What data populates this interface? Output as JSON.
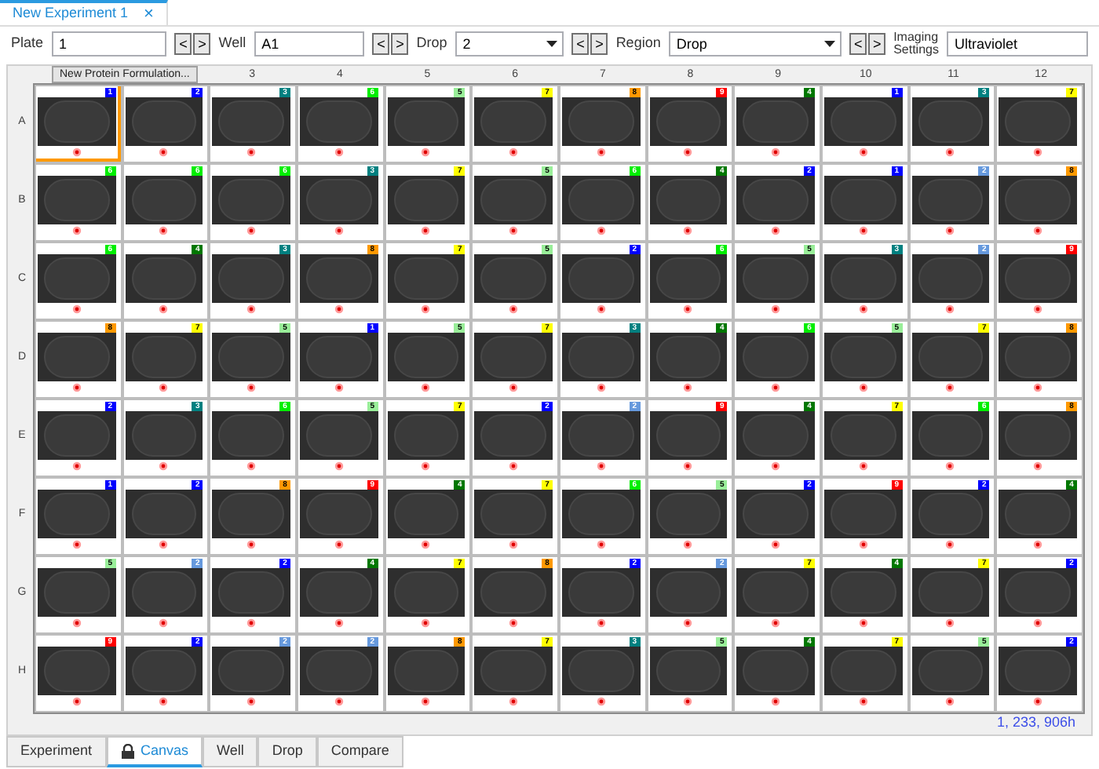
{
  "document_tab": {
    "title": "New Experiment 1",
    "close": "×"
  },
  "toolbar": {
    "plate": {
      "label": "Plate",
      "value": "1"
    },
    "well": {
      "label": "Well",
      "value": "A1"
    },
    "drop": {
      "label": "Drop",
      "value": "2"
    },
    "region": {
      "label": "Region",
      "value": "Drop"
    },
    "imaging": {
      "label": "Imaging Settings",
      "value": "Ultraviolet"
    },
    "prev": "<",
    "next": ">"
  },
  "formulation_button": "New Protein Formulation...",
  "column_headers": [
    "3",
    "4",
    "5",
    "6",
    "7",
    "8",
    "9",
    "10",
    "11",
    "12"
  ],
  "rows": [
    {
      "label": "A",
      "wells": [
        {
          "score": "1",
          "color": "#0000ff",
          "selected": true
        },
        {
          "score": "2",
          "color": "#0000ff",
          "selected": false
        },
        {
          "score": "3",
          "color": "#008080",
          "selected": false
        },
        {
          "score": "6",
          "color": "#00ee00",
          "selected": false
        },
        {
          "score": "5",
          "color": "#99ee99",
          "selected": false
        },
        {
          "score": "7",
          "color": "#ffff00",
          "selected": false
        },
        {
          "score": "8",
          "color": "#ff9900",
          "selected": false
        },
        {
          "score": "9",
          "color": "#ff0000",
          "selected": false
        },
        {
          "score": "4",
          "color": "#007700",
          "selected": false
        },
        {
          "score": "1",
          "color": "#0000ff",
          "selected": false
        },
        {
          "score": "3",
          "color": "#008080",
          "selected": false
        },
        {
          "score": "7",
          "color": "#ffff00",
          "selected": false
        }
      ]
    },
    {
      "label": "B",
      "wells": [
        {
          "score": "6",
          "color": "#00ee00",
          "selected": false
        },
        {
          "score": "6",
          "color": "#00ee00",
          "selected": false
        },
        {
          "score": "6",
          "color": "#00ee00",
          "selected": false
        },
        {
          "score": "3",
          "color": "#008080",
          "selected": false
        },
        {
          "score": "7",
          "color": "#ffff00",
          "selected": false
        },
        {
          "score": "5",
          "color": "#99ee99",
          "selected": false
        },
        {
          "score": "6",
          "color": "#00ee00",
          "selected": false
        },
        {
          "score": "4",
          "color": "#007700",
          "selected": false
        },
        {
          "score": "2",
          "color": "#0000ff",
          "selected": false
        },
        {
          "score": "1",
          "color": "#0000ff",
          "selected": false
        },
        {
          "score": "2",
          "color": "#6699dd",
          "selected": false
        },
        {
          "score": "8",
          "color": "#ff9900",
          "selected": false
        }
      ]
    },
    {
      "label": "C",
      "wells": [
        {
          "score": "6",
          "color": "#00ee00",
          "selected": false
        },
        {
          "score": "4",
          "color": "#007700",
          "selected": false
        },
        {
          "score": "3",
          "color": "#008080",
          "selected": false
        },
        {
          "score": "8",
          "color": "#ff9900",
          "selected": false
        },
        {
          "score": "7",
          "color": "#ffff00",
          "selected": false
        },
        {
          "score": "5",
          "color": "#99ee99",
          "selected": false
        },
        {
          "score": "2",
          "color": "#0000ff",
          "selected": false
        },
        {
          "score": "6",
          "color": "#00ee00",
          "selected": false
        },
        {
          "score": "5",
          "color": "#99ee99",
          "selected": false
        },
        {
          "score": "3",
          "color": "#008080",
          "selected": false
        },
        {
          "score": "2",
          "color": "#6699dd",
          "selected": false
        },
        {
          "score": "9",
          "color": "#ff0000",
          "selected": false
        }
      ]
    },
    {
      "label": "D",
      "wells": [
        {
          "score": "8",
          "color": "#ff9900",
          "selected": false
        },
        {
          "score": "7",
          "color": "#ffff00",
          "selected": false
        },
        {
          "score": "5",
          "color": "#99ee99",
          "selected": false
        },
        {
          "score": "1",
          "color": "#0000ff",
          "selected": false
        },
        {
          "score": "5",
          "color": "#99ee99",
          "selected": false
        },
        {
          "score": "7",
          "color": "#ffff00",
          "selected": false
        },
        {
          "score": "3",
          "color": "#008080",
          "selected": false
        },
        {
          "score": "4",
          "color": "#007700",
          "selected": false
        },
        {
          "score": "6",
          "color": "#00ee00",
          "selected": false
        },
        {
          "score": "5",
          "color": "#99ee99",
          "selected": false
        },
        {
          "score": "7",
          "color": "#ffff00",
          "selected": false
        },
        {
          "score": "8",
          "color": "#ff9900",
          "selected": false
        }
      ]
    },
    {
      "label": "E",
      "wells": [
        {
          "score": "2",
          "color": "#0000ff",
          "selected": false
        },
        {
          "score": "3",
          "color": "#008080",
          "selected": false
        },
        {
          "score": "6",
          "color": "#00ee00",
          "selected": false
        },
        {
          "score": "5",
          "color": "#99ee99",
          "selected": false
        },
        {
          "score": "7",
          "color": "#ffff00",
          "selected": false
        },
        {
          "score": "2",
          "color": "#0000ff",
          "selected": false
        },
        {
          "score": "2",
          "color": "#6699dd",
          "selected": false
        },
        {
          "score": "9",
          "color": "#ff0000",
          "selected": false
        },
        {
          "score": "4",
          "color": "#007700",
          "selected": false
        },
        {
          "score": "7",
          "color": "#ffff00",
          "selected": false
        },
        {
          "score": "6",
          "color": "#00ee00",
          "selected": false
        },
        {
          "score": "8",
          "color": "#ff9900",
          "selected": false
        }
      ]
    },
    {
      "label": "F",
      "wells": [
        {
          "score": "1",
          "color": "#0000ff",
          "selected": false
        },
        {
          "score": "2",
          "color": "#0000ff",
          "selected": false
        },
        {
          "score": "8",
          "color": "#ff9900",
          "selected": false
        },
        {
          "score": "9",
          "color": "#ff0000",
          "selected": false
        },
        {
          "score": "4",
          "color": "#007700",
          "selected": false
        },
        {
          "score": "7",
          "color": "#ffff00",
          "selected": false
        },
        {
          "score": "6",
          "color": "#00ee00",
          "selected": false
        },
        {
          "score": "5",
          "color": "#99ee99",
          "selected": false
        },
        {
          "score": "2",
          "color": "#0000ff",
          "selected": false
        },
        {
          "score": "9",
          "color": "#ff0000",
          "selected": false
        },
        {
          "score": "2",
          "color": "#0000ff",
          "selected": false
        },
        {
          "score": "4",
          "color": "#007700",
          "selected": false
        }
      ]
    },
    {
      "label": "G",
      "wells": [
        {
          "score": "5",
          "color": "#99ee99",
          "selected": false
        },
        {
          "score": "2",
          "color": "#6699dd",
          "selected": false
        },
        {
          "score": "2",
          "color": "#0000ff",
          "selected": false
        },
        {
          "score": "4",
          "color": "#007700",
          "selected": false
        },
        {
          "score": "7",
          "color": "#ffff00",
          "selected": false
        },
        {
          "score": "8",
          "color": "#ff9900",
          "selected": false
        },
        {
          "score": "2",
          "color": "#0000ff",
          "selected": false
        },
        {
          "score": "2",
          "color": "#6699dd",
          "selected": false
        },
        {
          "score": "7",
          "color": "#ffff00",
          "selected": false
        },
        {
          "score": "4",
          "color": "#007700",
          "selected": false
        },
        {
          "score": "7",
          "color": "#ffff00",
          "selected": false
        },
        {
          "score": "2",
          "color": "#0000ff",
          "selected": false
        }
      ]
    },
    {
      "label": "H",
      "wells": [
        {
          "score": "9",
          "color": "#ff0000",
          "selected": false
        },
        {
          "score": "2",
          "color": "#0000ff",
          "selected": false
        },
        {
          "score": "2",
          "color": "#6699dd",
          "selected": false
        },
        {
          "score": "2",
          "color": "#6699dd",
          "selected": false
        },
        {
          "score": "8",
          "color": "#ff9900",
          "selected": false
        },
        {
          "score": "7",
          "color": "#ffff00",
          "selected": false
        },
        {
          "score": "3",
          "color": "#008080",
          "selected": false
        },
        {
          "score": "5",
          "color": "#99ee99",
          "selected": false
        },
        {
          "score": "4",
          "color": "#007700",
          "selected": false
        },
        {
          "score": "7",
          "color": "#ffff00",
          "selected": false
        },
        {
          "score": "5",
          "color": "#99ee99",
          "selected": false
        },
        {
          "score": "2",
          "color": "#0000ff",
          "selected": false
        }
      ]
    }
  ],
  "elapsed": "1, 233, 906h",
  "bottom_tabs": [
    {
      "label": "Experiment",
      "selected": false,
      "locked": false
    },
    {
      "label": "Canvas",
      "selected": true,
      "locked": true
    },
    {
      "label": "Well",
      "selected": false,
      "locked": false
    },
    {
      "label": "Drop",
      "selected": false,
      "locked": false
    },
    {
      "label": "Compare",
      "selected": false,
      "locked": false
    }
  ]
}
